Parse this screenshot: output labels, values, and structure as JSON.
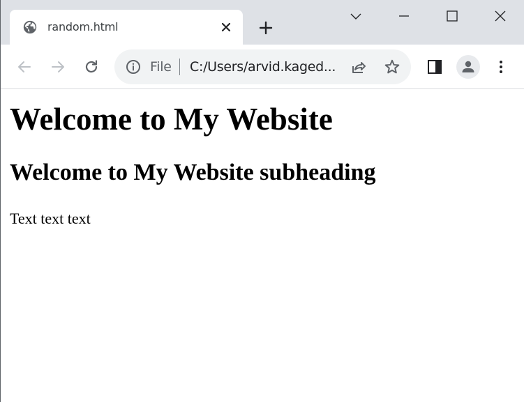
{
  "browser": {
    "tab": {
      "title": "random.html",
      "favicon": "globe-icon"
    },
    "window_controls": [
      "chevron-down-icon",
      "minimize-icon",
      "maximize-icon",
      "close-icon"
    ],
    "omnibox": {
      "scheme_label": "File",
      "url": "C:/Users/arvid.kaged..."
    },
    "toolbar_icons": [
      "back-arrow-icon",
      "forward-arrow-icon",
      "reload-icon",
      "info-icon",
      "share-icon",
      "star-icon",
      "side-panel-icon",
      "profile-icon",
      "kebab-menu-icon"
    ]
  },
  "page": {
    "heading": "Welcome to My Website",
    "subheading": "Welcome to My Website subheading",
    "paragraph": "Text text text"
  }
}
